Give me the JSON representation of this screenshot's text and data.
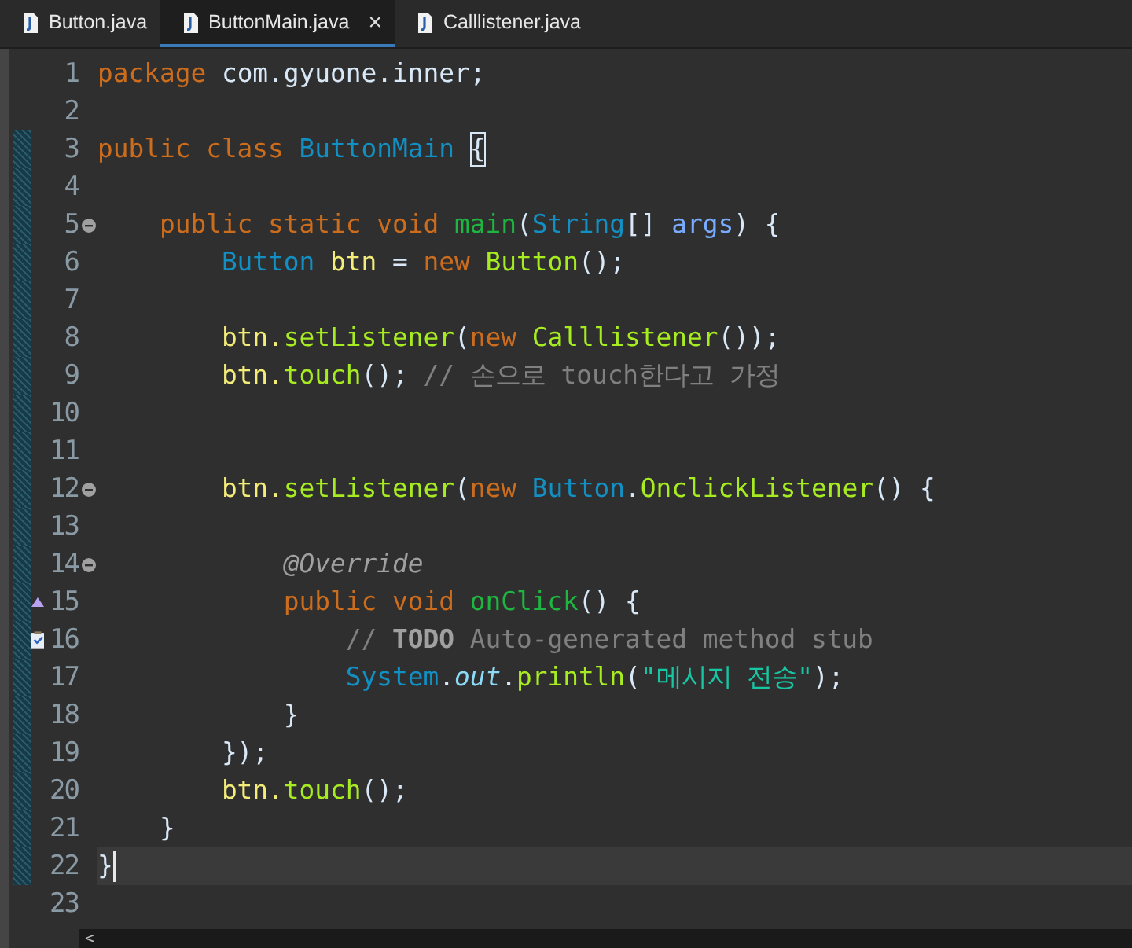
{
  "tabs": [
    {
      "label": "Button.java",
      "selected": false
    },
    {
      "label": "ButtonMain.java",
      "selected": true,
      "close": "×"
    },
    {
      "label": "Calllistener.java",
      "selected": false
    }
  ],
  "lines": [
    {
      "number": "1",
      "changed": false,
      "current": false,
      "foldable": false,
      "kind": "plain",
      "tokens": [
        {
          "text": "package",
          "kind": "keyword"
        },
        {
          "text": " com.gyuone.inner;",
          "kind": "plain"
        }
      ]
    },
    {
      "number": "2",
      "changed": false,
      "current": false,
      "foldable": false,
      "kind": "plain"
    },
    {
      "number": "3",
      "changed": true,
      "current": false,
      "foldable": false,
      "kind": "plain",
      "tokens": [
        {
          "text": "public class",
          "kind": "keyword"
        },
        {
          "text": " ButtonMain ",
          "kind": "type"
        },
        {
          "text": "{",
          "kind": "bracket"
        }
      ]
    },
    {
      "number": "4",
      "changed": true,
      "current": false,
      "foldable": false,
      "kind": "plain"
    },
    {
      "number": "5",
      "changed": true,
      "current": false,
      "foldable": true,
      "kind": "plain",
      "tokens": [
        {
          "text": "    public static void",
          "kind": "keyword"
        },
        {
          "text": " main",
          "kind": "decl"
        },
        {
          "text": "(",
          "kind": "plain"
        },
        {
          "text": "String",
          "kind": "type"
        },
        {
          "text": "[]",
          "kind": "plain"
        },
        {
          "text": " args",
          "kind": "param"
        },
        {
          "text": ") {",
          "kind": "plain"
        }
      ]
    },
    {
      "number": "6",
      "changed": true,
      "current": false,
      "foldable": false,
      "kind": "plain",
      "tokens": [
        {
          "text": "        Button",
          "kind": "type"
        },
        {
          "text": " btn",
          "kind": "var"
        },
        {
          "text": " =",
          "kind": "plain"
        },
        {
          "text": " new",
          "kind": "keyword"
        },
        {
          "text": " Button",
          "kind": "method"
        },
        {
          "text": "();",
          "kind": "plain"
        }
      ]
    },
    {
      "number": "7",
      "changed": true,
      "current": false,
      "foldable": false,
      "kind": "plain"
    },
    {
      "number": "8",
      "changed": true,
      "current": false,
      "foldable": false,
      "kind": "plain",
      "tokens": [
        {
          "text": "        btn.",
          "kind": "var"
        },
        {
          "text": "setListener",
          "kind": "method"
        },
        {
          "text": "(",
          "kind": "plain"
        },
        {
          "text": "new",
          "kind": "keyword"
        },
        {
          "text": " Calllistener",
          "kind": "method"
        },
        {
          "text": "());",
          "kind": "plain"
        }
      ]
    },
    {
      "number": "9",
      "changed": true,
      "current": false,
      "foldable": false,
      "kind": "plain",
      "tokens": [
        {
          "text": "        btn.",
          "kind": "var"
        },
        {
          "text": "touch",
          "kind": "method"
        },
        {
          "text": "();",
          "kind": "plain"
        },
        {
          "text": " // 손으로 touch한다고 가정",
          "kind": "comment"
        }
      ]
    },
    {
      "number": "10",
      "changed": true,
      "current": false,
      "foldable": false,
      "kind": "plain"
    },
    {
      "number": "11",
      "changed": true,
      "current": false,
      "foldable": false,
      "kind": "plain"
    },
    {
      "number": "12",
      "changed": true,
      "current": false,
      "foldable": true,
      "kind": "plain",
      "tokens": [
        {
          "text": "        btn.",
          "kind": "var"
        },
        {
          "text": "setListener",
          "kind": "method"
        },
        {
          "text": "(",
          "kind": "plain"
        },
        {
          "text": "new",
          "kind": "keyword"
        },
        {
          "text": " Button",
          "kind": "type"
        },
        {
          "text": ".",
          "kind": "plain"
        },
        {
          "text": "OnclickListener",
          "kind": "method"
        },
        {
          "text": "() {",
          "kind": "plain"
        }
      ]
    },
    {
      "number": "13",
      "changed": true,
      "current": false,
      "foldable": false,
      "kind": "plain"
    },
    {
      "number": "14",
      "changed": true,
      "current": false,
      "foldable": true,
      "kind": "plain",
      "tokens": [
        {
          "text": "            @Override",
          "kind": "annotation"
        }
      ]
    },
    {
      "number": "15",
      "changed": true,
      "current": false,
      "foldable": false,
      "kind": "override",
      "tokens": [
        {
          "text": "            public void",
          "kind": "keyword"
        },
        {
          "text": " onClick",
          "kind": "decl"
        },
        {
          "text": "() {",
          "kind": "plain"
        }
      ]
    },
    {
      "number": "16",
      "changed": true,
      "current": false,
      "foldable": false,
      "kind": "task",
      "tokens": [
        {
          "text": "                // ",
          "kind": "comment"
        },
        {
          "text": "TODO",
          "kind": "todo"
        },
        {
          "text": " Auto-generated method stub",
          "kind": "comment"
        }
      ]
    },
    {
      "number": "17",
      "changed": true,
      "current": false,
      "foldable": false,
      "kind": "plain",
      "tokens": [
        {
          "text": "                System",
          "kind": "type"
        },
        {
          "text": ".",
          "kind": "plain"
        },
        {
          "text": "out",
          "kind": "field"
        },
        {
          "text": ".",
          "kind": "plain"
        },
        {
          "text": "println",
          "kind": "method"
        },
        {
          "text": "(",
          "kind": "plain"
        },
        {
          "text": "\"메시지 전송\"",
          "kind": "string"
        },
        {
          "text": ");",
          "kind": "plain"
        }
      ]
    },
    {
      "number": "18",
      "changed": true,
      "current": false,
      "foldable": false,
      "kind": "plain",
      "tokens": [
        {
          "text": "            }",
          "kind": "plain"
        }
      ]
    },
    {
      "number": "19",
      "changed": true,
      "current": false,
      "foldable": false,
      "kind": "plain",
      "tokens": [
        {
          "text": "        });",
          "kind": "plain"
        }
      ]
    },
    {
      "number": "20",
      "changed": true,
      "current": false,
      "foldable": false,
      "kind": "plain",
      "tokens": [
        {
          "text": "        btn.",
          "kind": "var"
        },
        {
          "text": "touch",
          "kind": "method"
        },
        {
          "text": "();",
          "kind": "plain"
        }
      ]
    },
    {
      "number": "21",
      "changed": true,
      "current": false,
      "foldable": false,
      "kind": "plain",
      "tokens": [
        {
          "text": "    }",
          "kind": "plain"
        }
      ]
    },
    {
      "number": "22",
      "changed": true,
      "current": true,
      "foldable": false,
      "kind": "plain",
      "tokens": [
        {
          "text": "}",
          "kind": "plain"
        }
      ]
    },
    {
      "number": "23",
      "changed": false,
      "current": false,
      "foldable": false,
      "kind": "plain"
    }
  ],
  "scrollbar": {
    "arrow": "<"
  }
}
